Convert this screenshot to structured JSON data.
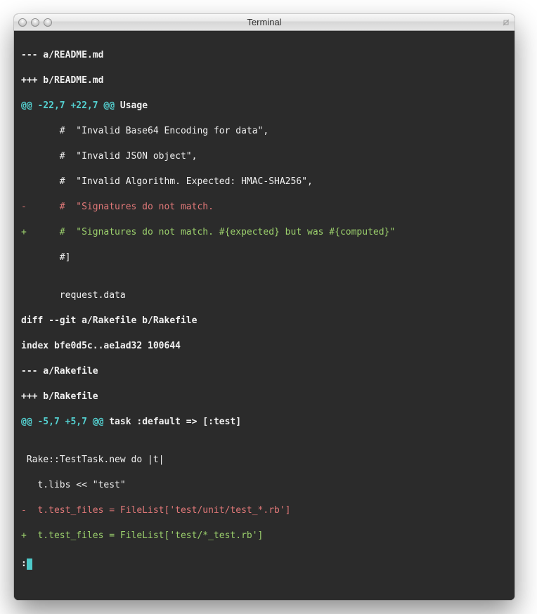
{
  "window": {
    "title": "Terminal"
  },
  "diff": {
    "file1_minus": "--- a/README.md",
    "file1_plus": "+++ b/README.md",
    "hunk1_left": "@@ -22,7 +22,7 @@",
    "hunk1_right": " Usage",
    "ctx1_a": "       #  \"Invalid Base64 Encoding for data\",",
    "ctx1_b": "       #  \"Invalid JSON object\",",
    "ctx1_c": "       #  \"Invalid Algorithm. Expected: HMAC-SHA256\",",
    "del1": "-      #  \"Signatures do not match.",
    "add1": "+      #  \"Signatures do not match. #{expected} but was #{computed}\"",
    "ctx1_d": "       #]",
    "blank1": "",
    "ctx1_e": "       request.data",
    "diff_cmd": "diff --git a/Rakefile b/Rakefile",
    "index_line": "index bfe0d5c..ae1ad32 100644",
    "file2_minus": "--- a/Rakefile",
    "file2_plus": "+++ b/Rakefile",
    "hunk2_left": "@@ -5,7 +5,7 @@",
    "hunk2_right": " task :default => [:test]",
    "blank2": "",
    "ctx2_a": " Rake::TestTask.new do |t|",
    "ctx2_b": "   t.libs << \"test\"",
    "del2": "-  t.test_files = FileList['test/unit/test_*.rb']",
    "add2": "+  t.test_files = FileList['test/*_test.rb']",
    "prompt": ":"
  }
}
